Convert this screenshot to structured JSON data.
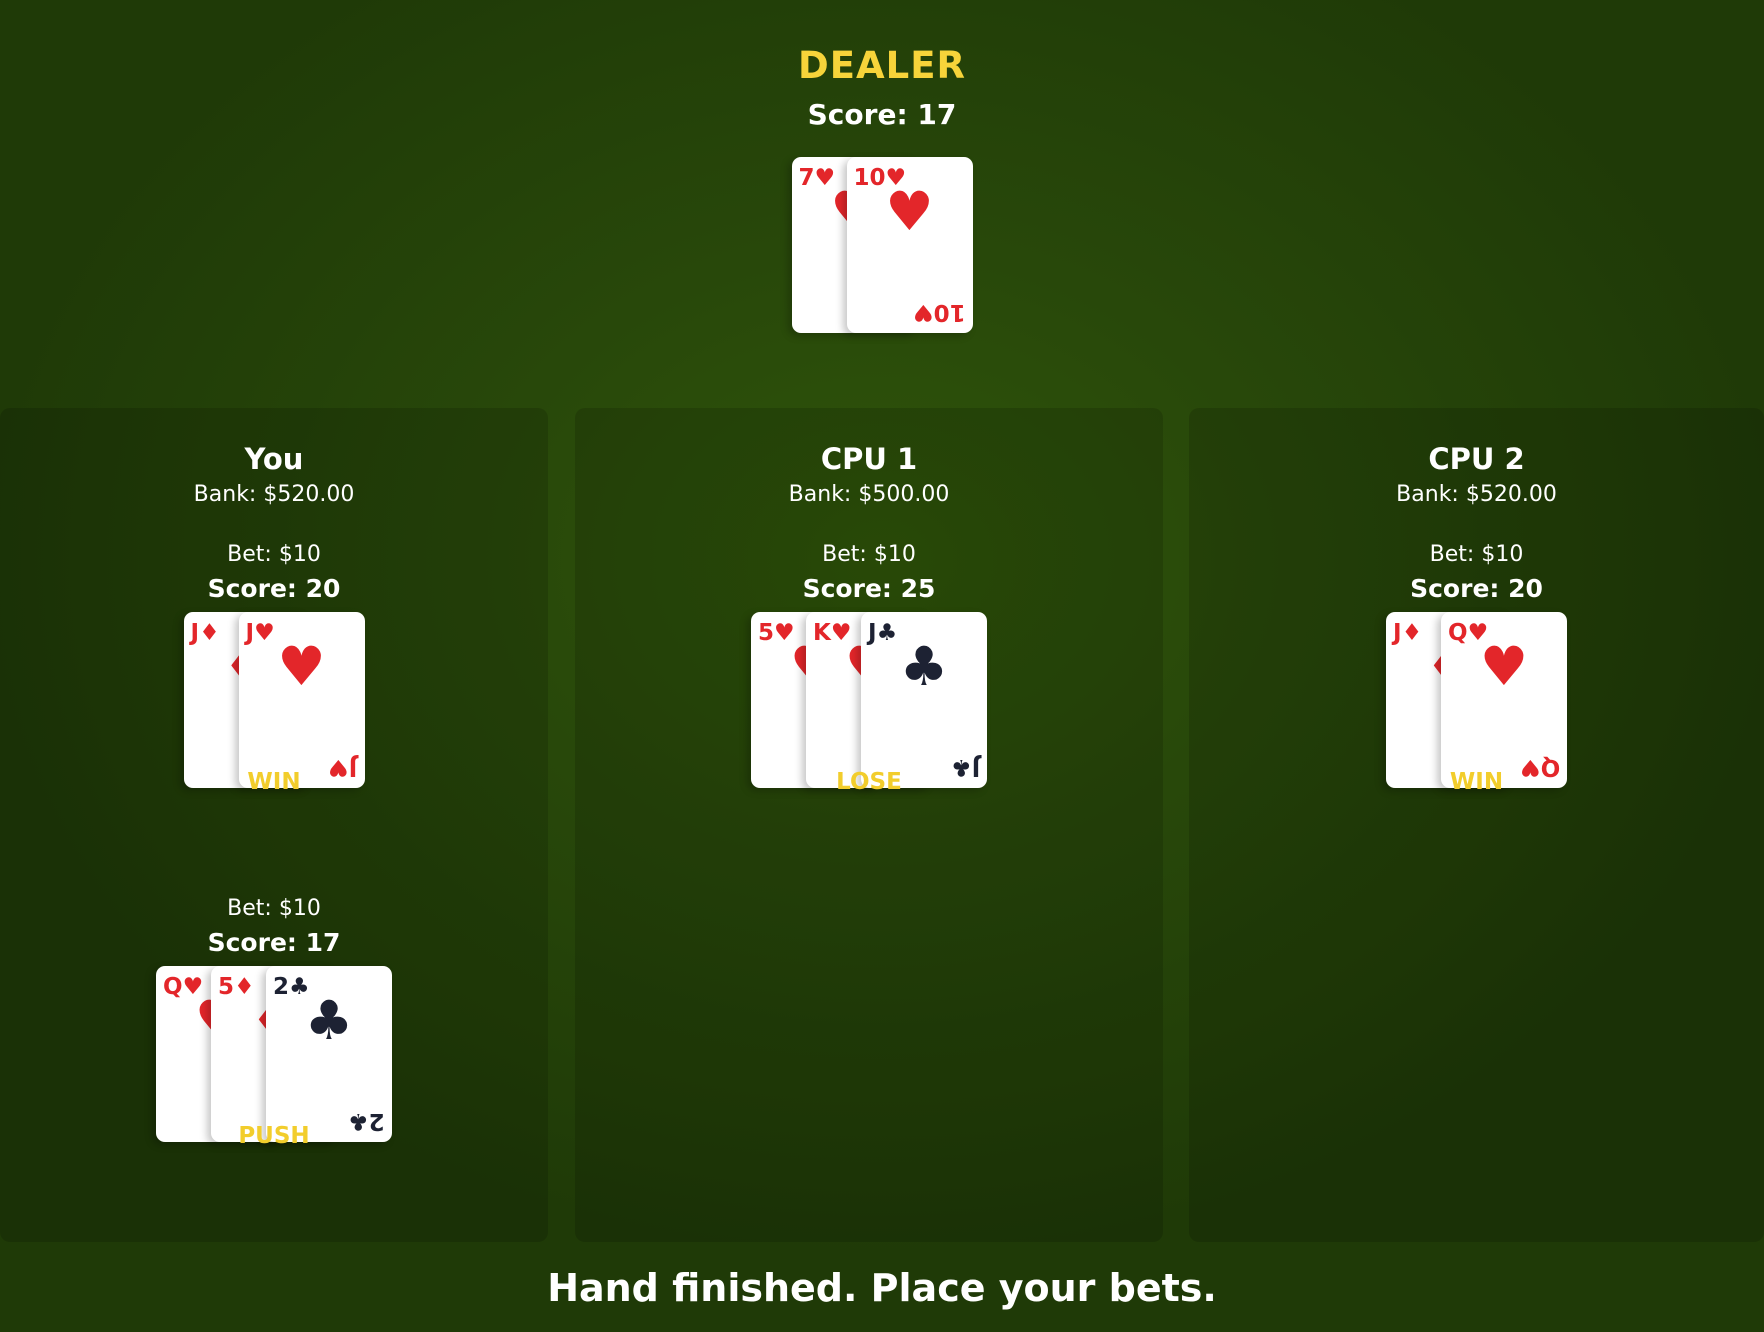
{
  "dealer": {
    "title": "DEALER",
    "score_text": "Score: 17",
    "cards": [
      {
        "rank": "7",
        "suit": "♥",
        "color": "red"
      },
      {
        "rank": "10",
        "suit": "♥",
        "color": "red"
      }
    ]
  },
  "players": [
    {
      "name": "You",
      "bank": "Bank: $520.00",
      "hands": [
        {
          "bet": "Bet: $10",
          "score": "Score: 20",
          "result": "WIN",
          "cards": [
            {
              "rank": "J",
              "suit": "♦",
              "color": "red"
            },
            {
              "rank": "J",
              "suit": "♥",
              "color": "red"
            }
          ]
        },
        {
          "bet": "Bet: $10",
          "score": "Score: 17",
          "result": "PUSH",
          "cards": [
            {
              "rank": "Q",
              "suit": "♥",
              "color": "red"
            },
            {
              "rank": "5",
              "suit": "♦",
              "color": "red"
            },
            {
              "rank": "2",
              "suit": "♣",
              "color": "black"
            }
          ]
        }
      ]
    },
    {
      "name": "CPU 1",
      "bank": "Bank: $500.00",
      "hands": [
        {
          "bet": "Bet: $10",
          "score": "Score: 25",
          "result": "LOSE",
          "cards": [
            {
              "rank": "5",
              "suit": "♥",
              "color": "red"
            },
            {
              "rank": "K",
              "suit": "♥",
              "color": "red"
            },
            {
              "rank": "J",
              "suit": "♣",
              "color": "black"
            }
          ]
        }
      ]
    },
    {
      "name": "CPU 2",
      "bank": "Bank: $520.00",
      "hands": [
        {
          "bet": "Bet: $10",
          "score": "Score: 20",
          "result": "WIN",
          "cards": [
            {
              "rank": "J",
              "suit": "♦",
              "color": "red"
            },
            {
              "rank": "Q",
              "suit": "♥",
              "color": "red"
            }
          ]
        }
      ]
    }
  ],
  "status": "Hand finished. Place your bets.",
  "colors": {
    "accent": "#f7d43a",
    "result": "#f2cd2c",
    "red_suit": "#e3262a",
    "black_suit": "#1d2233",
    "felt": "#2b4f09"
  }
}
